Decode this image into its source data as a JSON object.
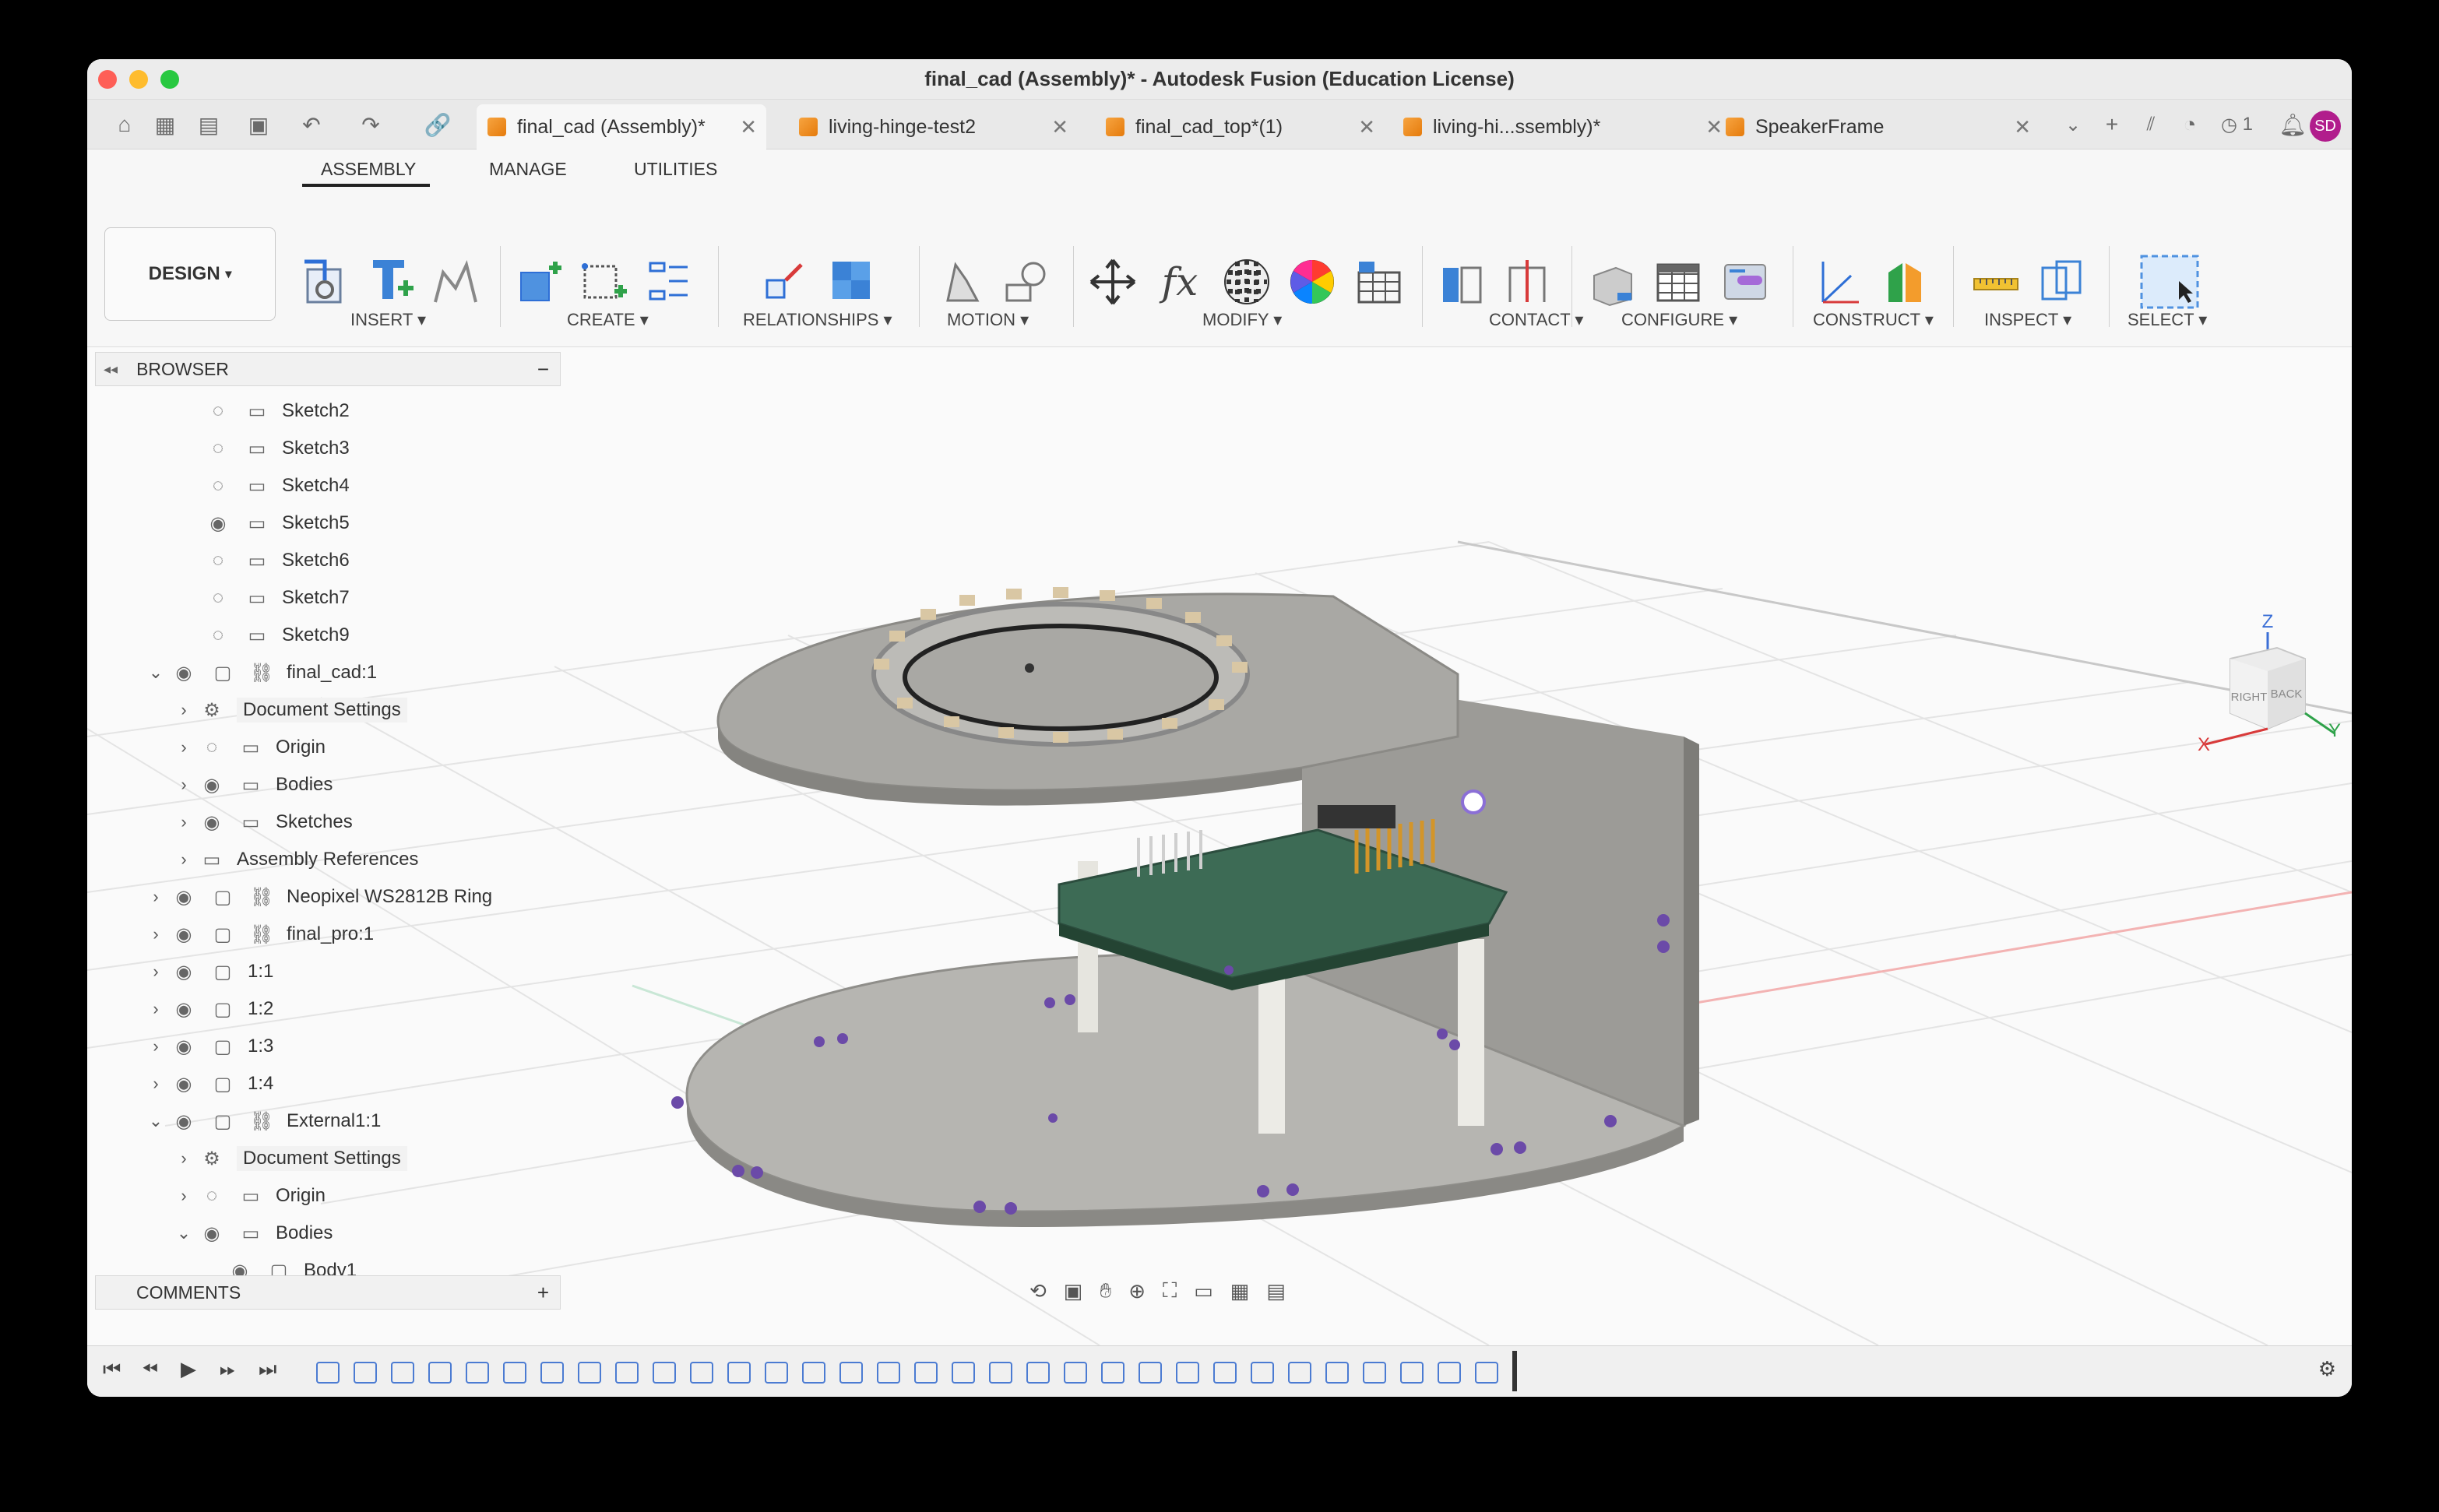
{
  "window": {
    "title": "final_cad (Assembly)* - Autodesk Fusion (Education License)"
  },
  "tabs": [
    {
      "label": "final_cad (Assembly)*",
      "active": true
    },
    {
      "label": "living-hinge-test2",
      "active": false
    },
    {
      "label": "final_cad_top*(1)",
      "active": false
    },
    {
      "label": "living-hi...ssembly)*",
      "active": false
    },
    {
      "label": "SpeakerFrame",
      "active": false
    }
  ],
  "tabbar_right": {
    "job_count": "1",
    "user_initials": "SD"
  },
  "ribbon": {
    "workspace": "DESIGN",
    "tabs": [
      "ASSEMBLY",
      "MANAGE",
      "UTILITIES"
    ],
    "groups": [
      "INSERT",
      "CREATE",
      "RELATIONSHIPS",
      "MOTION",
      "MODIFY",
      "CONTACT",
      "CONFIGURE",
      "CONSTRUCT",
      "INSPECT",
      "SELECT"
    ]
  },
  "browser": {
    "title": "BROWSER",
    "items": [
      {
        "label": "Sketch2",
        "icon": "sketch-icon",
        "visible": false
      },
      {
        "label": "Sketch3",
        "icon": "sketch-icon",
        "visible": false
      },
      {
        "label": "Sketch4",
        "icon": "sketch-icon",
        "visible": false
      },
      {
        "label": "Sketch5",
        "icon": "sketch-icon",
        "visible": true
      },
      {
        "label": "Sketch6",
        "icon": "sketch-icon",
        "visible": false
      },
      {
        "label": "Sketch7",
        "icon": "sketch-icon",
        "visible": false
      },
      {
        "label": "Sketch9",
        "icon": "sketch-icon",
        "visible": false
      },
      {
        "label": "final_cad:1",
        "icon": "component-link-icon",
        "visible": true
      },
      {
        "label": "Document Settings",
        "icon": "gear-icon"
      },
      {
        "label": "Origin",
        "icon": "folder-icon",
        "visible": false
      },
      {
        "label": "Bodies",
        "icon": "folder-icon",
        "visible": true
      },
      {
        "label": "Sketches",
        "icon": "folder-icon",
        "visible": true
      },
      {
        "label": "Assembly References",
        "icon": "folder-icon"
      },
      {
        "label": "Neopixel WS2812B Ring",
        "icon": "component-link-icon",
        "visible": true
      },
      {
        "label": "final_pro:1",
        "icon": "component-link-icon",
        "visible": true
      },
      {
        "label": "1:1",
        "icon": "component-icon",
        "visible": true
      },
      {
        "label": "1:2",
        "icon": "component-icon",
        "visible": true
      },
      {
        "label": "1:3",
        "icon": "component-icon",
        "visible": true
      },
      {
        "label": "1:4",
        "icon": "component-icon",
        "visible": true
      },
      {
        "label": "External1:1",
        "icon": "component-link-icon",
        "visible": true
      },
      {
        "label": "Document Settings",
        "icon": "gear-icon"
      },
      {
        "label": "Origin",
        "icon": "folder-icon",
        "visible": false
      },
      {
        "label": "Bodies",
        "icon": "folder-icon",
        "visible": true
      },
      {
        "label": "Body1",
        "icon": "body-icon",
        "visible": true
      }
    ]
  },
  "comments": {
    "title": "COMMENTS"
  },
  "viewcube": {
    "z": "Z",
    "x": "X",
    "y": "Y",
    "right": "RIGHT",
    "back": "BACK"
  }
}
